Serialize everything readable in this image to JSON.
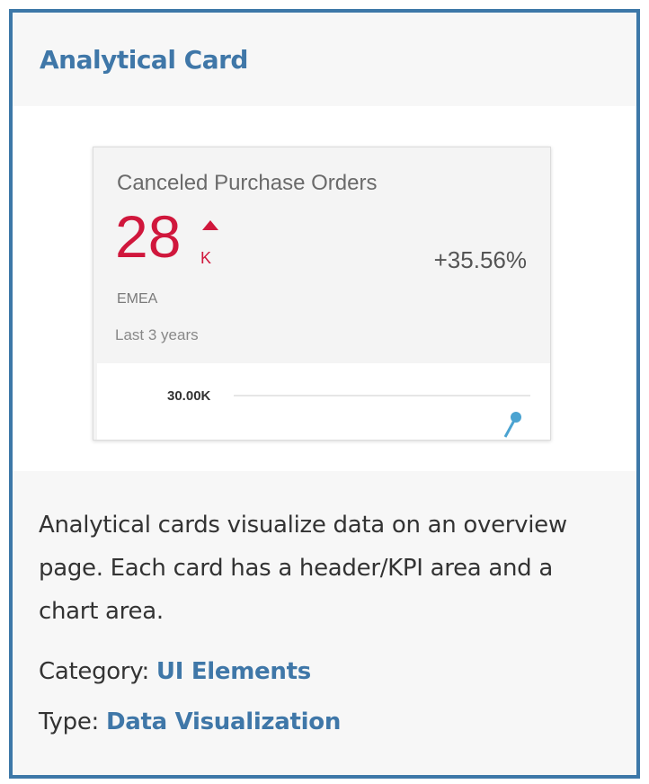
{
  "panel": {
    "title": "Analytical Card",
    "description": "Analytical cards visualize data on an overview page. Each card has a header/KPI area and a chart area.",
    "category_label": "Category:",
    "category_value": "UI Elements",
    "type_label": "Type:",
    "type_value": "Data Visualization"
  },
  "card": {
    "title": "Canceled Purchase Orders",
    "kpi_value": "28",
    "kpi_unit": "K",
    "kpi_trend_icon": "triangle-up-icon",
    "kpi_delta": "+35.56%",
    "region": "EMEA",
    "period": "Last 3 years"
  },
  "chart_data": {
    "type": "line",
    "tick_labels": [
      "30.00K"
    ],
    "grid": true
  },
  "colors": {
    "frame_border": "#3d78a8",
    "link": "#3f77a8",
    "kpi_negative": "#d0173c",
    "series": "#4ba3d1"
  }
}
